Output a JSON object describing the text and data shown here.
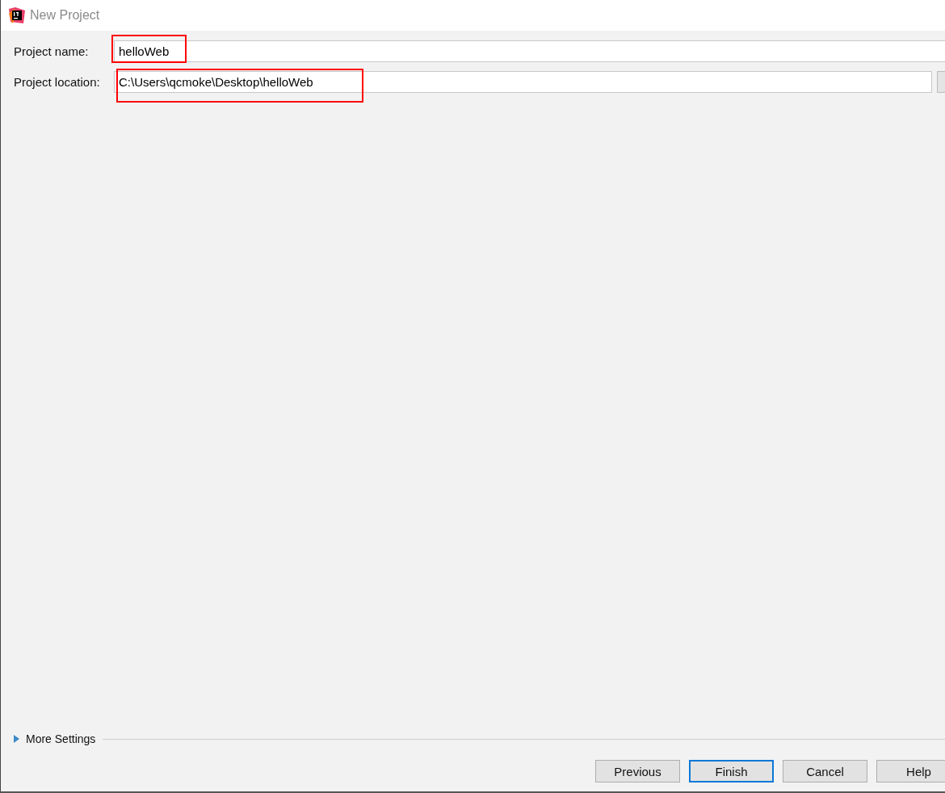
{
  "window": {
    "title": "New Project"
  },
  "fields": [
    {
      "label": "Project name:",
      "value": "helloWeb",
      "highlighted": true,
      "browse": false
    },
    {
      "label": "Project location:",
      "value": "C:\\Users\\qcmoke\\Desktop\\helloWeb",
      "highlighted": true,
      "browse": true
    }
  ],
  "more_settings": {
    "label": "More Settings",
    "expanded": false
  },
  "buttons": [
    {
      "label": "Previous",
      "focused": false
    },
    {
      "label": "Finish",
      "focused": true
    },
    {
      "label": "Cancel",
      "focused": false
    },
    {
      "label": "Help",
      "focused": false
    }
  ]
}
